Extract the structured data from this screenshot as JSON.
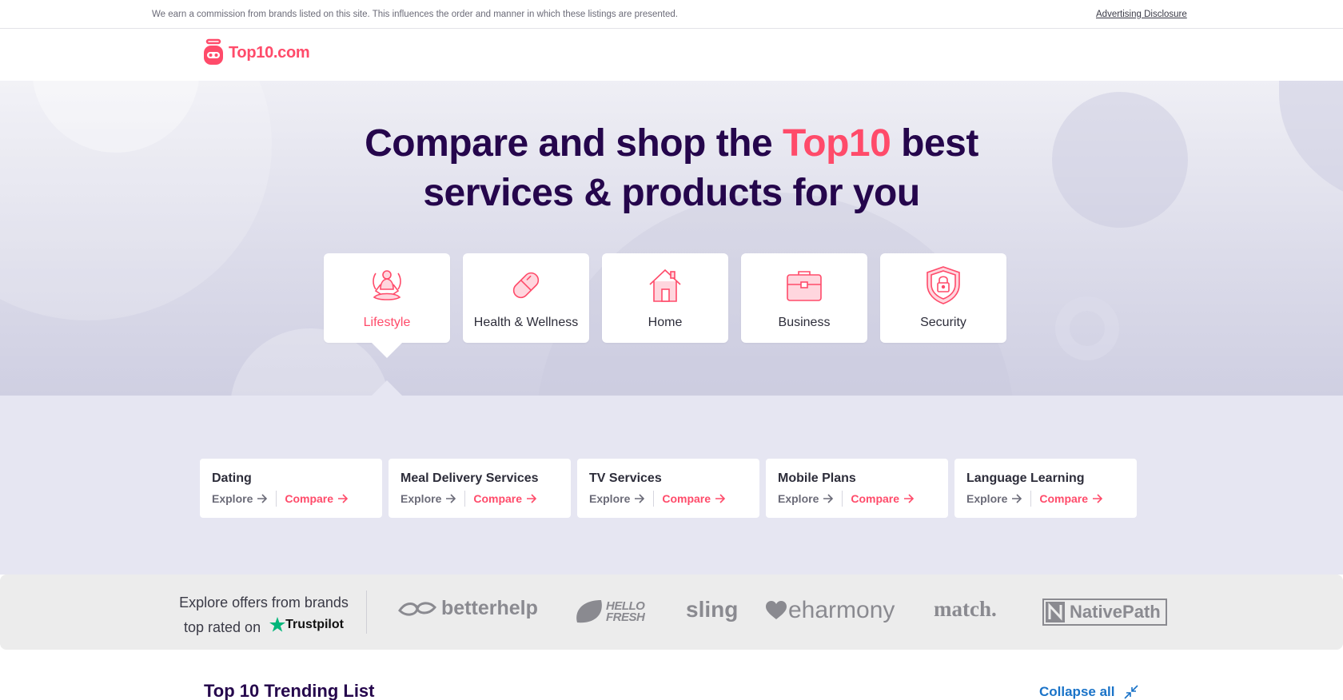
{
  "topbar": {
    "notice": "We earn a commission from brands listed on this site. This influences the order and manner in which these listings are presented.",
    "disclosure_link": "Advertising Disclosure"
  },
  "header": {
    "logo_text": "Top10.com"
  },
  "hero": {
    "headline_part1": "Compare and shop the ",
    "headline_accent": "Top10",
    "headline_part2": " best",
    "headline_line2": "services & products for you"
  },
  "categories": [
    {
      "label": "Lifestyle",
      "icon": "meditation-icon",
      "active": true
    },
    {
      "label": "Health & Wellness",
      "icon": "pill-icon",
      "active": false
    },
    {
      "label": "Home",
      "icon": "house-icon",
      "active": false
    },
    {
      "label": "Business",
      "icon": "briefcase-icon",
      "active": false
    },
    {
      "label": "Security",
      "icon": "shield-lock-icon",
      "active": false
    }
  ],
  "subcategories": [
    {
      "title": "Dating",
      "explore": "Explore",
      "compare": "Compare"
    },
    {
      "title": "Meal Delivery Services",
      "explore": "Explore",
      "compare": "Compare"
    },
    {
      "title": "TV Services",
      "explore": "Explore",
      "compare": "Compare"
    },
    {
      "title": "Mobile Plans",
      "explore": "Explore",
      "compare": "Compare"
    },
    {
      "title": "Language Learning",
      "explore": "Explore",
      "compare": "Compare"
    }
  ],
  "brands": {
    "lead_line1": "Explore offers from brands",
    "lead_line2": "top rated on",
    "trustpilot": "Trustpilot",
    "logos": [
      "betterhelp",
      "HELLO FRESH",
      "sling",
      "eharmony",
      "match.",
      "NativePath"
    ]
  },
  "trending": {
    "title": "Top 10 Trending List",
    "collapse_label": "Collapse all"
  },
  "colors": {
    "brand_pink": "#ff4b6a",
    "navy": "#25064c",
    "link_blue": "#1a73c8",
    "trustpilot_green": "#00b67a"
  }
}
